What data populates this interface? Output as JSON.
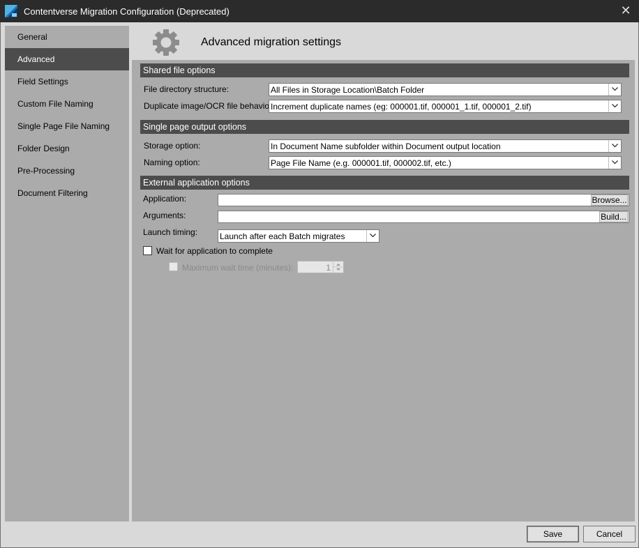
{
  "window": {
    "title": "Contentverse Migration Configuration (Deprecated)",
    "close_label": "✕"
  },
  "sidebar": {
    "items": [
      {
        "label": "General",
        "active": false
      },
      {
        "label": "Advanced",
        "active": true
      },
      {
        "label": "Field Settings",
        "active": false
      },
      {
        "label": "Custom File Naming",
        "active": false
      },
      {
        "label": "Single Page File Naming",
        "active": false
      },
      {
        "label": "Folder Design",
        "active": false
      },
      {
        "label": "Pre-Processing",
        "active": false
      },
      {
        "label": "Document Filtering",
        "active": false
      }
    ]
  },
  "header": {
    "title": "Advanced migration settings",
    "icon": "gear-icon"
  },
  "shared": {
    "title": "Shared file options",
    "dir_label": "File directory structure:",
    "dir_value": "All Files in Storage Location\\Batch Folder",
    "dup_label": "Duplicate image/OCR file behavior:",
    "dup_value": "Increment duplicate names (eg: 000001.tif, 000001_1.tif, 000001_2.tif)"
  },
  "single": {
    "title": "Single page output options",
    "storage_label": "Storage option:",
    "storage_value": "In Document Name subfolder within Document output location",
    "naming_label": "Naming option:",
    "naming_value": "Page File Name (e.g. 000001.tif, 000002.tif, etc.)"
  },
  "external": {
    "title": "External application options",
    "app_label": "Application:",
    "app_value": "",
    "browse_label": "Browse...",
    "args_label": "Arguments:",
    "args_value": "",
    "build_label": "Build...",
    "timing_label": "Launch timing:",
    "timing_value": "Launch after each Batch migrates",
    "wait_label": "Wait for application to complete",
    "wait_checked": false,
    "maxwait_label": "Maximum wait time (minutes):",
    "maxwait_value": "1"
  },
  "footer": {
    "save_label": "Save",
    "cancel_label": "Cancel"
  },
  "colors": {
    "titlebar": "#2b2b2b",
    "panel": "#ababab",
    "section": "#4c4c4c",
    "active_nav": "#4c4c4c",
    "window": "#d9d9d9"
  }
}
